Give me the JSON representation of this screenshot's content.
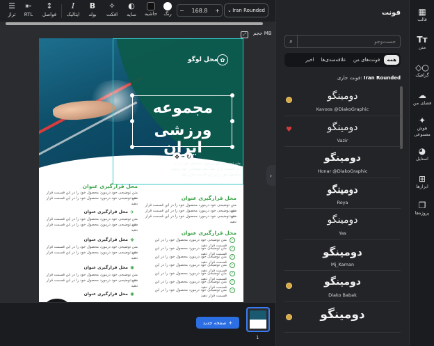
{
  "toolbar": {
    "align": "تراز",
    "rtl": "RTL",
    "spacing": "فواصل",
    "italic": "ایتالیک",
    "bold": "بولد",
    "effect": "افکت",
    "shadow": "سایه",
    "border": "حاشیه",
    "color": "رنگ",
    "font_size": "168.8",
    "minus": "−",
    "plus": "+",
    "font_name": "Iran Rounded"
  },
  "canvas": {
    "size_label": "حجم MB",
    "logo_text": "محل لوگو",
    "title_line1": "مجموعه",
    "title_line2": "ورزشی ایران",
    "hero_desc": [
      "متن توضیحی خود درمورد محصول خود را در",
      "این قسمت قرار دهید متن توضیحی خود درمورد",
      "محصول خود را در این قسمت قرار دهید"
    ],
    "section_title": "محل قرارگیری عنوان",
    "item_title": "محل قرارگیری عنوان",
    "body_line": "متن توضیحی خود درمورد محصول خود را در این قسمت قرار دهید"
  },
  "bottom": {
    "new_page": "صفحه جدید",
    "page_number": "1"
  },
  "panel": {
    "title": "فونت",
    "search_placeholder": "جست‌وجو",
    "tabs": [
      "همه",
      "فونت‌های من",
      "علاقه‌مندی‌ها",
      "اخیر"
    ],
    "current_label": "فونت جاری:",
    "current_value": "Iran Rounded",
    "fonts": [
      {
        "sample": "دومینگو",
        "name": "Kavoos @DiakoGraphic",
        "mark": "badge"
      },
      {
        "sample": "دومینگو",
        "name": "Vazir",
        "mark": "heart"
      },
      {
        "sample": "دومینگو",
        "name": "Honar @DiakoGraphic",
        "mark": "none"
      },
      {
        "sample": "دومینگو",
        "name": "Roya",
        "mark": "none"
      },
      {
        "sample": "دومینگو",
        "name": "Yas",
        "mark": "none"
      },
      {
        "sample": "دومینگو",
        "name": "Mj_Kaman",
        "mark": "none"
      },
      {
        "sample": "دومینگو",
        "name": "Diako Babak",
        "mark": "badge"
      },
      {
        "sample": "دومینگو",
        "name": "",
        "mark": "badge"
      }
    ]
  },
  "nav": {
    "template": "قالب",
    "text": "متن",
    "graphic": "گرافیک",
    "space": "فضای من",
    "ai": "هوش مصنوعی",
    "style": "استایل",
    "tools": "ابزارها",
    "projects": "پروژه‌ها"
  },
  "colors": {
    "accent": "#2c6fe3",
    "selection": "#35c6c8",
    "green": "#3ea34b",
    "dark_bg": "#1e1f22"
  }
}
